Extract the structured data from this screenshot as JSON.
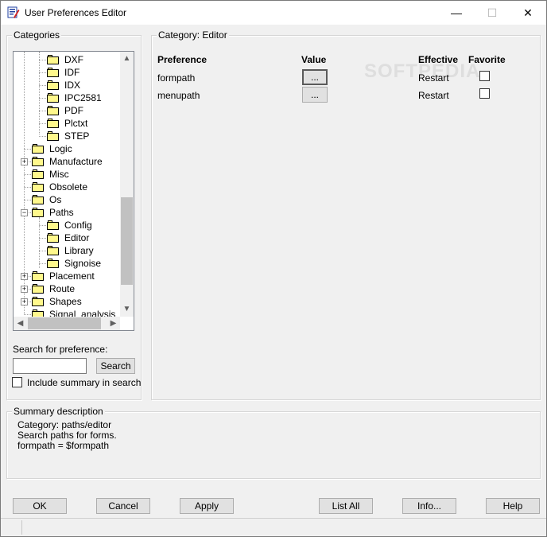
{
  "window": {
    "title": "User Preferences Editor",
    "minimize_glyph": "—",
    "maximize_glyph": "☐",
    "close_glyph": "✕"
  },
  "categories": {
    "label": "Categories",
    "tree": [
      {
        "label": "DXF",
        "level": 2
      },
      {
        "label": "IDF",
        "level": 2
      },
      {
        "label": "IDX",
        "level": 2
      },
      {
        "label": "IPC2581",
        "level": 2
      },
      {
        "label": "PDF",
        "level": 2
      },
      {
        "label": "Plctxt",
        "level": 2
      },
      {
        "label": "STEP",
        "level": 2
      },
      {
        "label": "Logic",
        "level": 1
      },
      {
        "label": "Manufacture",
        "level": 1,
        "expander": "+"
      },
      {
        "label": "Misc",
        "level": 1
      },
      {
        "label": "Obsolete",
        "level": 1
      },
      {
        "label": "Os",
        "level": 1
      },
      {
        "label": "Paths",
        "level": 1,
        "expander": "−"
      },
      {
        "label": "Config",
        "level": 2
      },
      {
        "label": "Editor",
        "level": 2
      },
      {
        "label": "Library",
        "level": 2
      },
      {
        "label": "Signoise",
        "level": 2
      },
      {
        "label": "Placement",
        "level": 1,
        "expander": "+"
      },
      {
        "label": "Route",
        "level": 1,
        "expander": "+"
      },
      {
        "label": "Shapes",
        "level": 1,
        "expander": "+"
      },
      {
        "label": "Signal_analysis",
        "level": 1
      }
    ]
  },
  "search": {
    "label": "Search for preference:",
    "value": "",
    "button": "Search",
    "include_summary_label": "Include summary in search",
    "include_summary_checked": false
  },
  "category_panel": {
    "label": "Category:  Editor",
    "headers": {
      "preference": "Preference",
      "value": "Value",
      "effective": "Effective",
      "favorite": "Favorite"
    },
    "rows": [
      {
        "preference": "formpath",
        "value_button": "...",
        "effective": "Restart",
        "favorite": false
      },
      {
        "preference": "menupath",
        "value_button": "...",
        "effective": "Restart",
        "favorite": false
      }
    ]
  },
  "summary": {
    "label": "Summary description",
    "lines": [
      "Category: paths/editor",
      "Search paths for forms.",
      "formpath = $formpath"
    ]
  },
  "footer_buttons": {
    "ok": "OK",
    "cancel": "Cancel",
    "apply": "Apply",
    "list_all": "List All",
    "info": "Info...",
    "help": "Help"
  },
  "watermark": "SOFTPEDIA",
  "colors": {
    "folder": "#fff88c",
    "window_bg": "#f0f0f0"
  }
}
